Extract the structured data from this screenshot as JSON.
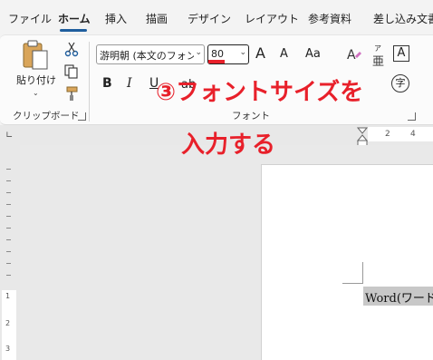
{
  "menu": {
    "tabs": [
      "ファイル",
      "ホーム",
      "挿入",
      "描画",
      "デザイン",
      "レイアウト",
      "参考資料",
      "差し込み文書"
    ],
    "active": "ホーム"
  },
  "clipboard": {
    "paste_label": "貼り付け",
    "group_label": "クリップボード"
  },
  "font": {
    "font_name": "游明朝 (本文のフォン",
    "font_size": "80",
    "group_label": "フォント",
    "bold": "B",
    "italic": "I",
    "underline": "U",
    "strike": "ab",
    "case_label": "Aa",
    "grow": "A",
    "shrink": "A",
    "ruby_top": "ア",
    "ruby_base": "亜",
    "char_border": "A",
    "enclose": "字"
  },
  "annotation": {
    "line1": "③フォントサイズを",
    "line2": "入力する",
    "color": "#e8202a"
  },
  "ruler": {
    "top_numbers": [
      "2",
      "4"
    ],
    "left_numbers": [
      "1",
      "2",
      "3"
    ]
  },
  "document": {
    "text": "Word(ワード"
  },
  "colors": {
    "accent": "#1f5e9e",
    "ribbon_bg": "#fbfbfb",
    "highlight": "#c8c8c8"
  }
}
